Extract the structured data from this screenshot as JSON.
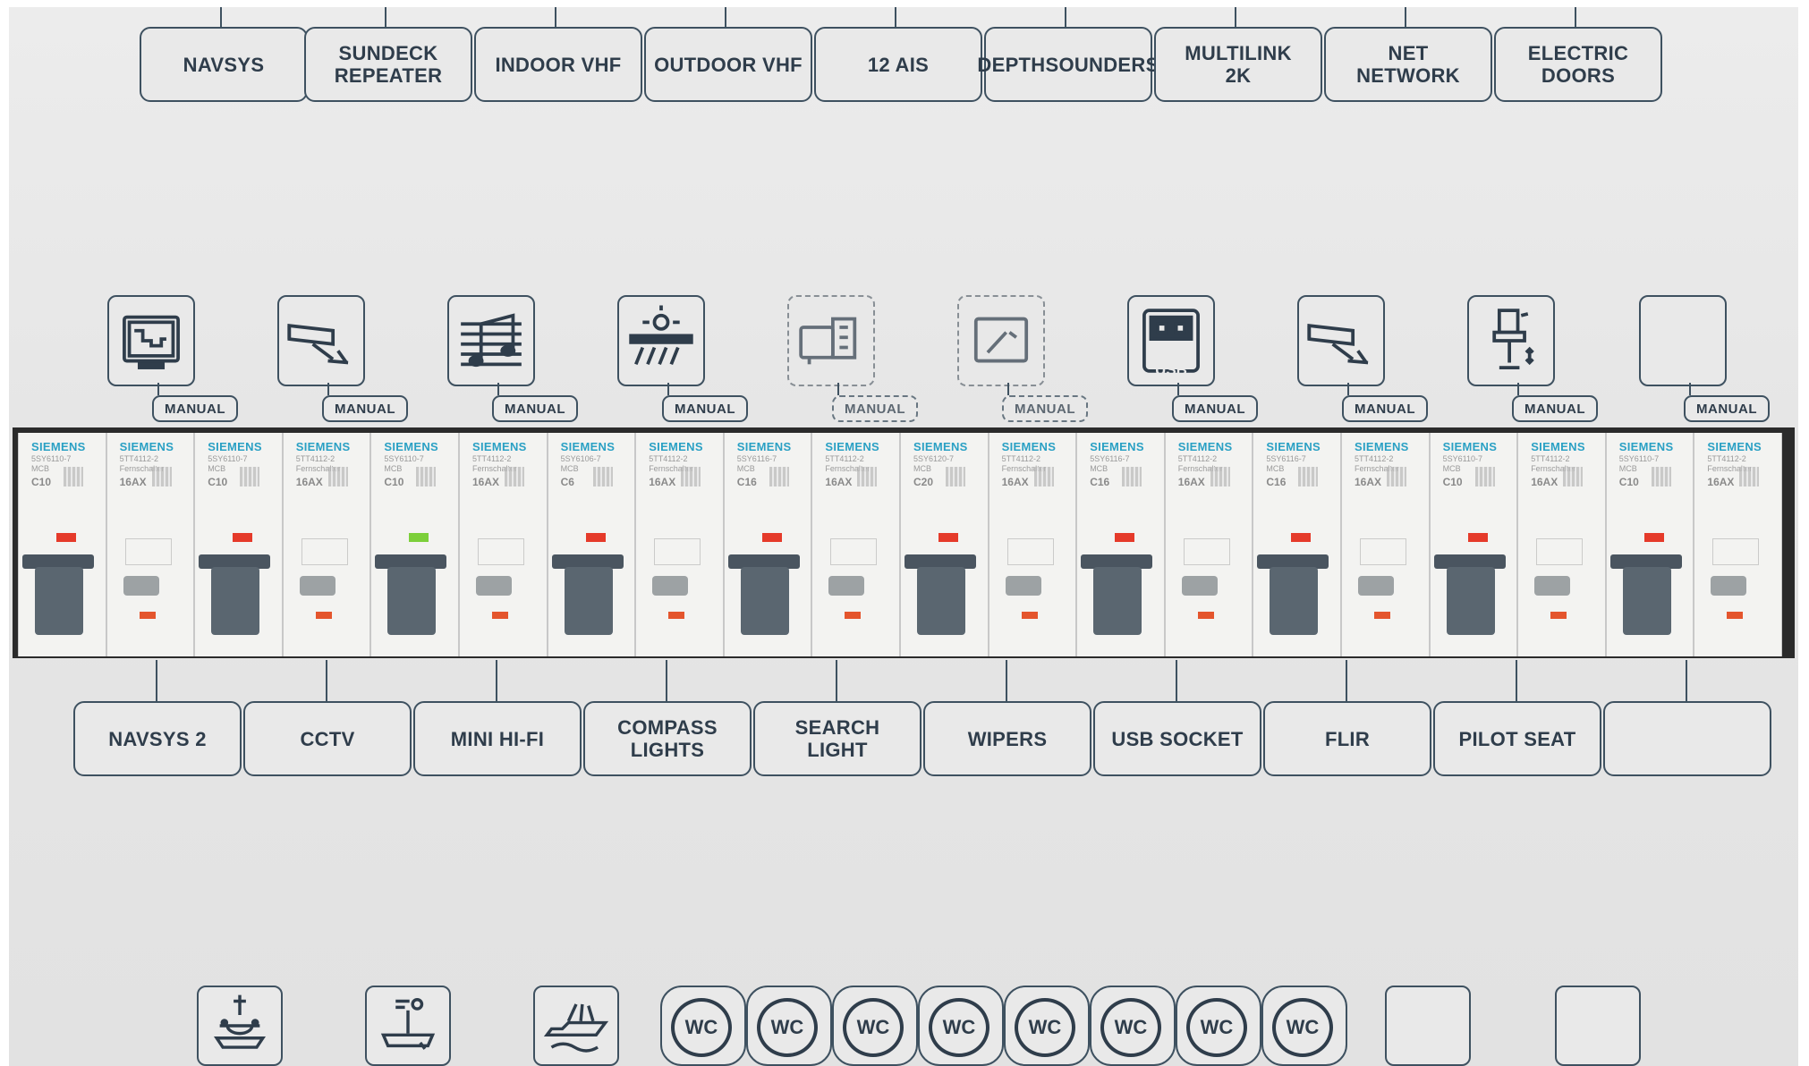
{
  "top_labels": [
    {
      "text": "NAVSYS"
    },
    {
      "text": "SUNDECK\nREPEATER"
    },
    {
      "text": "INDOOR VHF"
    },
    {
      "text": "OUTDOOR VHF"
    },
    {
      "text": "12 AIS"
    },
    {
      "text": "DEPTHSOUNDERS"
    },
    {
      "text": "MULTILINK\n2K"
    },
    {
      "text": "NET\nNETWORK"
    },
    {
      "text": "ELECTRIC\nDOORS"
    }
  ],
  "icon_row": [
    {
      "icon": "navigation-display-icon",
      "manual": "MANUAL",
      "faded": false
    },
    {
      "icon": "cctv-camera-icon",
      "manual": "MANUAL",
      "faded": false
    },
    {
      "icon": "music-notes-icon",
      "manual": "MANUAL",
      "faded": false
    },
    {
      "icon": "compass-lights-icon",
      "manual": "MANUAL",
      "faded": false
    },
    {
      "icon": "search-light-icon",
      "manual": "MANUAL",
      "faded": true
    },
    {
      "icon": "wipers-icon",
      "manual": "MANUAL",
      "faded": true
    },
    {
      "icon": "usb-socket-icon",
      "manual": "MANUAL",
      "faded": false
    },
    {
      "icon": "flir-camera-icon",
      "manual": "MANUAL",
      "faded": false
    },
    {
      "icon": "pilot-seat-icon",
      "manual": "MANUAL",
      "faded": false
    },
    {
      "icon": "blank-icon",
      "manual": "MANUAL",
      "faded": false
    }
  ],
  "usb_text": "USB",
  "breakers": [
    {
      "brand": "SIEMENS",
      "model": "5SY6110-7\nMCB",
      "rating": "C10",
      "indicator": "#e53a2a"
    },
    {
      "brand": "SIEMENS",
      "model": "5TT4112-2\nFernschalter",
      "rating": "16AX",
      "indicator": ""
    },
    {
      "brand": "SIEMENS",
      "model": "5SY6110-7\nMCB",
      "rating": "C10",
      "indicator": "#e53a2a"
    },
    {
      "brand": "SIEMENS",
      "model": "5TT4112-2\nFernschalter",
      "rating": "16AX",
      "indicator": ""
    },
    {
      "brand": "SIEMENS",
      "model": "5SY6110-7\nMCB",
      "rating": "C10",
      "indicator": "#7ccf3a"
    },
    {
      "brand": "SIEMENS",
      "model": "5TT4112-2\nFernschalter",
      "rating": "16AX",
      "indicator": ""
    },
    {
      "brand": "SIEMENS",
      "model": "5SY6106-7\nMCB",
      "rating": "C6",
      "indicator": "#e53a2a"
    },
    {
      "brand": "SIEMENS",
      "model": "5TT4112-2\nFernschalter",
      "rating": "16AX",
      "indicator": ""
    },
    {
      "brand": "SIEMENS",
      "model": "5SY6116-7\nMCB",
      "rating": "C16",
      "indicator": "#e53a2a"
    },
    {
      "brand": "SIEMENS",
      "model": "5TT4112-2\nFernschalter",
      "rating": "16AX",
      "indicator": ""
    },
    {
      "brand": "SIEMENS",
      "model": "5SY6120-7\nMCB",
      "rating": "C20",
      "indicator": "#e53a2a"
    },
    {
      "brand": "SIEMENS",
      "model": "5TT4112-2\nFernschalter",
      "rating": "16AX",
      "indicator": ""
    },
    {
      "brand": "SIEMENS",
      "model": "5SY6116-7\nMCB",
      "rating": "C16",
      "indicator": "#e53a2a"
    },
    {
      "brand": "SIEMENS",
      "model": "5TT4112-2\nFernschalter",
      "rating": "16AX",
      "indicator": ""
    },
    {
      "brand": "SIEMENS",
      "model": "5SY6116-7\nMCB",
      "rating": "C16",
      "indicator": "#e53a2a"
    },
    {
      "brand": "SIEMENS",
      "model": "5TT4112-2\nFernschalter",
      "rating": "16AX",
      "indicator": ""
    },
    {
      "brand": "SIEMENS",
      "model": "5SY6110-7\nMCB",
      "rating": "C10",
      "indicator": "#e53a2a"
    },
    {
      "brand": "SIEMENS",
      "model": "5TT4112-2\nFernschalter",
      "rating": "16AX",
      "indicator": ""
    },
    {
      "brand": "SIEMENS",
      "model": "5SY6110-7\nMCB",
      "rating": "C10",
      "indicator": "#e53a2a"
    },
    {
      "brand": "SIEMENS",
      "model": "5TT4112-2\nFernschalter",
      "rating": "16AX",
      "indicator": ""
    }
  ],
  "bottom_labels": [
    {
      "text": "NAVSYS 2"
    },
    {
      "text": "CCTV"
    },
    {
      "text": "MINI HI-FI"
    },
    {
      "text": "COMPASS\nLIGHTS"
    },
    {
      "text": "SEARCH\nLIGHT"
    },
    {
      "text": "WIPERS"
    },
    {
      "text": "USB SOCKET"
    },
    {
      "text": "FLIR"
    },
    {
      "text": "PILOT SEAT"
    },
    {
      "text": ""
    }
  ],
  "bottom_icons": [
    {
      "icon": "anchor-windlass-icon"
    },
    {
      "icon": "helm-station-icon"
    },
    {
      "icon": "boat-light-icon"
    },
    {
      "icon": "wc-icon",
      "text": "WC"
    },
    {
      "icon": "wc-icon",
      "text": "WC"
    },
    {
      "icon": "wc-icon",
      "text": "WC"
    },
    {
      "icon": "wc-icon",
      "text": "WC"
    },
    {
      "icon": "wc-icon",
      "text": "WC"
    },
    {
      "icon": "wc-icon",
      "text": "WC"
    },
    {
      "icon": "wc-icon",
      "text": "WC"
    },
    {
      "icon": "wc-icon",
      "text": "WC"
    },
    {
      "icon": "blank-icon"
    },
    {
      "icon": "blank-icon"
    }
  ],
  "colors": {
    "panel": "#e6e6e6",
    "ink": "#3e5160",
    "siemens": "#2aa0c4",
    "indicator_red": "#e53a2a",
    "indicator_green": "#7ccf3a"
  }
}
